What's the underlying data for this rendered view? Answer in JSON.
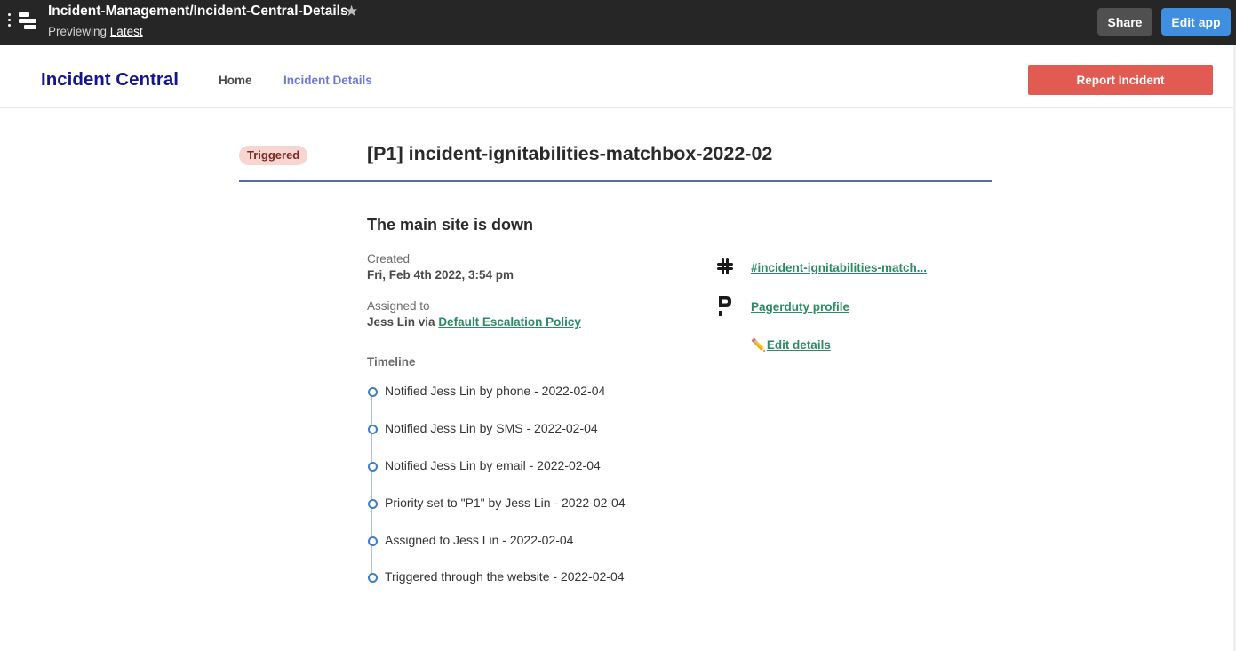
{
  "topbar": {
    "title": "Incident-Management/Incident-Central-Details",
    "previewing_prefix": "Previewing",
    "previewing_version": "Latest",
    "share_label": "Share",
    "edit_app_label": "Edit app",
    "icons": [
      "kebab-menu-icon",
      "app-logo-icon",
      "star-icon"
    ]
  },
  "header": {
    "brand": "Incident Central",
    "nav": [
      {
        "label": "Home",
        "active": false
      },
      {
        "label": "Incident Details",
        "active": true
      }
    ],
    "report_button": "Report Incident",
    "report_color": "#e15b52",
    "brand_color": "#14148f"
  },
  "incident": {
    "status": "Triggered",
    "title": "[P1] incident-ignitabilities-matchbox-2022-02",
    "summary": "The main site is down",
    "created_label": "Created",
    "created_value": "Fri, Feb 4th 2022, 3:54 pm",
    "assigned_label": "Assigned to",
    "assigned_prefix": "Jess Lin via",
    "assigned_policy": "Default Escalation Policy",
    "timeline_label": "Timeline",
    "timeline": [
      "Notified Jess Lin by phone - 2022-02-04",
      "Notified Jess Lin by SMS - 2022-02-04",
      "Notified Jess Lin by email - 2022-02-04",
      "Priority set to \"P1\" by Jess Lin - 2022-02-04",
      "Assigned to Jess Lin - 2022-02-04",
      "Triggered through the website - 2022-02-04"
    ]
  },
  "links": {
    "slack_channel": "#incident-ignitabilities-match...",
    "pagerduty": "Pagerduty profile",
    "edit_icon": "✏️",
    "edit_details": "Edit details",
    "link_color": "#2c8a64"
  }
}
